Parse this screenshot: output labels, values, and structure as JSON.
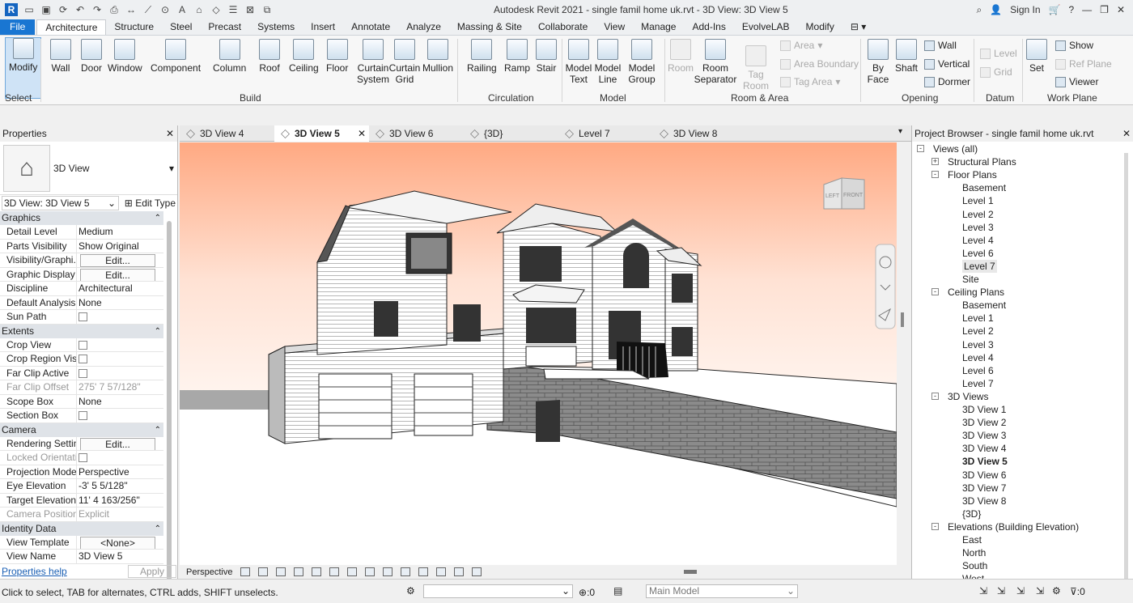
{
  "app": {
    "title": "Autodesk Revit 2021 - single famil home uk.rvt - 3D View: 3D View 5",
    "sign_in": "Sign In"
  },
  "tabs": [
    "File",
    "Architecture",
    "Structure",
    "Steel",
    "Precast",
    "Systems",
    "Insert",
    "Annotate",
    "Analyze",
    "Massing & Site",
    "Collaborate",
    "View",
    "Manage",
    "Add-Ins",
    "EvolveLAB",
    "Modify"
  ],
  "ribbon": {
    "select": {
      "modify": "Modify",
      "select": "Select"
    },
    "build": [
      "Wall",
      "Door",
      "Window",
      "Component",
      "Column",
      "Roof",
      "Ceiling",
      "Floor",
      "Curtain System",
      "Curtain Grid",
      "Mullion"
    ],
    "circulation": [
      "Railing",
      "Ramp",
      "Stair"
    ],
    "model": [
      "Model Text",
      "Model Line",
      "Model Group"
    ],
    "room": {
      "room": "Room",
      "separator": "Room Separator",
      "tag": "Tag Room",
      "area": "Area",
      "boundary": "Area Boundary",
      "tag_area": "Tag Area"
    },
    "opening": {
      "by_face": "By Face",
      "shaft": "Shaft",
      "wall": "Wall",
      "vertical": "Vertical",
      "dormer": "Dormer"
    },
    "datum": {
      "level": "Level",
      "grid": "Grid"
    },
    "workplane": {
      "set": "Set",
      "show": "Show",
      "ref": "Ref Plane",
      "viewer": "Viewer"
    },
    "groups": {
      "select": "Select",
      "build": "Build",
      "circulation": "Circulation",
      "model": "Model",
      "room": "Room & Area",
      "opening": "Opening",
      "datum": "Datum",
      "workplane": "Work Plane"
    }
  },
  "properties": {
    "title": "Properties",
    "type": "3D View",
    "selector": "3D View: 3D View 5",
    "edit_type": "Edit Type",
    "sections": [
      {
        "name": "Graphics",
        "rows": [
          {
            "n": "Detail Level",
            "v": "Medium",
            "k": "text"
          },
          {
            "n": "Parts Visibility",
            "v": "Show Original",
            "k": "text"
          },
          {
            "n": "Visibility/Graphi...",
            "v": "Edit...",
            "k": "button"
          },
          {
            "n": "Graphic Display ...",
            "v": "Edit...",
            "k": "button"
          },
          {
            "n": "Discipline",
            "v": "Architectural",
            "k": "text"
          },
          {
            "n": "Default Analysis ...",
            "v": "None",
            "k": "text"
          },
          {
            "n": "Sun Path",
            "v": "",
            "k": "check"
          }
        ]
      },
      {
        "name": "Extents",
        "rows": [
          {
            "n": "Crop View",
            "v": "",
            "k": "check"
          },
          {
            "n": "Crop Region Visi...",
            "v": "",
            "k": "check"
          },
          {
            "n": "Far Clip Active",
            "v": "",
            "k": "check"
          },
          {
            "n": "Far Clip Offset",
            "v": "275'  7 57/128\"",
            "k": "dim"
          },
          {
            "n": "Scope Box",
            "v": "None",
            "k": "text"
          },
          {
            "n": "Section Box",
            "v": "",
            "k": "check"
          }
        ]
      },
      {
        "name": "Camera",
        "rows": [
          {
            "n": "Rendering Settin...",
            "v": "Edit...",
            "k": "button"
          },
          {
            "n": "Locked Orientati...",
            "v": "",
            "k": "dimcheck"
          },
          {
            "n": "Projection Mode",
            "v": "Perspective",
            "k": "text"
          },
          {
            "n": "Eye Elevation",
            "v": "-3'  5 5/128\"",
            "k": "text"
          },
          {
            "n": "Target Elevation",
            "v": "11'  4 163/256\"",
            "k": "text"
          },
          {
            "n": "Camera Position",
            "v": "Explicit",
            "k": "dim"
          }
        ]
      },
      {
        "name": "Identity Data",
        "rows": [
          {
            "n": "View Template",
            "v": "<None>",
            "k": "button"
          },
          {
            "n": "View Name",
            "v": "3D View 5",
            "k": "text"
          }
        ]
      }
    ],
    "help": "Properties help",
    "apply": "Apply"
  },
  "view_tabs": [
    {
      "label": "3D View 4",
      "active": false
    },
    {
      "label": "3D View 5",
      "active": true
    },
    {
      "label": "3D View 6",
      "active": false
    },
    {
      "label": "{3D}",
      "active": false
    },
    {
      "label": "Level 7",
      "active": false
    },
    {
      "label": "3D View 8",
      "active": false
    }
  ],
  "viewcube": {
    "left": "LEFT",
    "front": "FRONT"
  },
  "view_bar": {
    "mode": "Perspective"
  },
  "browser": {
    "title": "Project Browser - single famil home uk.rvt",
    "items": [
      {
        "label": "Views (all)",
        "level": 0,
        "tog": "-"
      },
      {
        "label": "Structural Plans",
        "level": 1,
        "tog": "+"
      },
      {
        "label": "Floor Plans",
        "level": 1,
        "tog": "-"
      },
      {
        "label": "Basement",
        "level": 2
      },
      {
        "label": "Level 1",
        "level": 2
      },
      {
        "label": "Level 2",
        "level": 2
      },
      {
        "label": "Level 3",
        "level": 2
      },
      {
        "label": "Level 4",
        "level": 2
      },
      {
        "label": "Level 6",
        "level": 2
      },
      {
        "label": "Level 7",
        "level": 2,
        "highlight": true
      },
      {
        "label": "Site",
        "level": 2
      },
      {
        "label": "Ceiling Plans",
        "level": 1,
        "tog": "-"
      },
      {
        "label": "Basement",
        "level": 2
      },
      {
        "label": "Level 1",
        "level": 2
      },
      {
        "label": "Level 2",
        "level": 2
      },
      {
        "label": "Level 3",
        "level": 2
      },
      {
        "label": "Level 4",
        "level": 2
      },
      {
        "label": "Level 6",
        "level": 2
      },
      {
        "label": "Level 7",
        "level": 2
      },
      {
        "label": "3D Views",
        "level": 1,
        "tog": "-"
      },
      {
        "label": "3D View 1",
        "level": 2
      },
      {
        "label": "3D View 2",
        "level": 2
      },
      {
        "label": "3D View 3",
        "level": 2
      },
      {
        "label": "3D View 4",
        "level": 2
      },
      {
        "label": "3D View 5",
        "level": 2,
        "bold": true
      },
      {
        "label": "3D View 6",
        "level": 2
      },
      {
        "label": "3D View 7",
        "level": 2
      },
      {
        "label": "3D View 8",
        "level": 2
      },
      {
        "label": "{3D}",
        "level": 2
      },
      {
        "label": "Elevations (Building Elevation)",
        "level": 1,
        "tog": "-"
      },
      {
        "label": "East",
        "level": 2
      },
      {
        "label": "North",
        "level": 2
      },
      {
        "label": "South",
        "level": 2
      },
      {
        "label": "West",
        "level": 2
      }
    ]
  },
  "status": {
    "text": "Click to select, TAB for alternates, CTRL adds, SHIFT unselects.",
    "zero": ":0",
    "model": "Main Model",
    "filter": ":0"
  }
}
